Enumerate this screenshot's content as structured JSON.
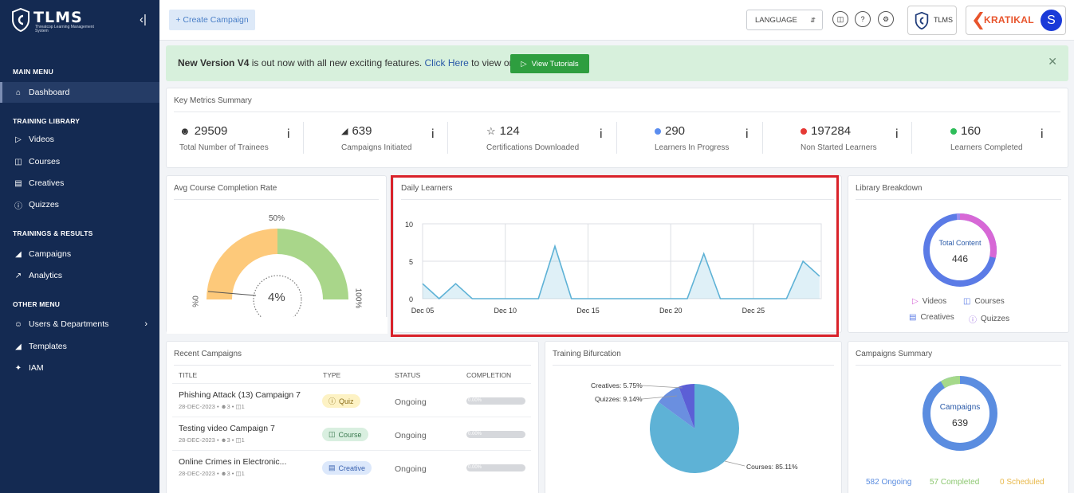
{
  "sidebar": {
    "brand": "TLMS",
    "brand_sub": "Threatcop Learning Management System",
    "collapse_icon": "collapse-icon",
    "sections": {
      "main": "MAIN MENU",
      "library": "TRAINING LIBRARY",
      "results": "TRAININGS & RESULTS",
      "other": "OTHER MENU"
    },
    "items": {
      "dashboard": "Dashboard",
      "videos": "Videos",
      "courses": "Courses",
      "creatives": "Creatives",
      "quizzes": "Quizzes",
      "campaigns": "Campaigns",
      "analytics": "Analytics",
      "users": "Users & Departments",
      "templates": "Templates",
      "iam": "IAM"
    }
  },
  "topbar": {
    "create_campaign": "+ Create Campaign",
    "language": "LANGUAGE",
    "tlms_label": "TLMS",
    "kratikal": "KRATIKAL",
    "avatar": "S"
  },
  "banner": {
    "version": "New Version V4",
    "text_mid": " is out now with all new exciting features. ",
    "link": "Click Here",
    "text_end": " to view or",
    "button": "View Tutorials"
  },
  "metrics": {
    "title": "Key Metrics Summary",
    "items": [
      {
        "value": "29509",
        "label": "Total Number of Trainees"
      },
      {
        "value": "639",
        "label": "Campaigns Initiated"
      },
      {
        "value": "124",
        "label": "Certifications Downloaded"
      },
      {
        "value": "290",
        "label": "Learners In Progress",
        "color": "#5b8def"
      },
      {
        "value": "197284",
        "label": "Non Started Learners",
        "color": "#e53935"
      },
      {
        "value": "160",
        "label": "Learners Completed",
        "color": "#2ebd59"
      }
    ],
    "info": "i"
  },
  "completion": {
    "title": "Avg Course Completion Rate",
    "value": "4%",
    "label_0": "0%",
    "label_50": "50%",
    "label_100": "100%"
  },
  "daily": {
    "title": "Daily Learners"
  },
  "chart_data": {
    "type": "area",
    "y_ticks": [
      "0",
      "5",
      "10"
    ],
    "ylim": [
      0,
      10
    ],
    "x_labels": [
      "Dec 05",
      "Dec 10",
      "Dec 15",
      "Dec 20",
      "Dec 25"
    ],
    "x_start_day": 5,
    "x_end_day": 29,
    "points": [
      {
        "day": 5,
        "v": 2
      },
      {
        "day": 6,
        "v": 0
      },
      {
        "day": 7,
        "v": 2
      },
      {
        "day": 8,
        "v": 0
      },
      {
        "day": 12,
        "v": 0
      },
      {
        "day": 13,
        "v": 7
      },
      {
        "day": 14,
        "v": 0
      },
      {
        "day": 21,
        "v": 0
      },
      {
        "day": 22,
        "v": 6
      },
      {
        "day": 23,
        "v": 0
      },
      {
        "day": 27,
        "v": 0
      },
      {
        "day": 28,
        "v": 5
      },
      {
        "day": 29,
        "v": 3
      }
    ],
    "color": "#5eb2d6"
  },
  "library": {
    "title": "Library Breakdown",
    "center_label": "Total Content",
    "center_value": "446",
    "legend": [
      "Videos",
      "Courses",
      "Creatives",
      "Quizzes"
    ]
  },
  "recent": {
    "title": "Recent Campaigns",
    "headers": [
      "TITLE",
      "TYPE",
      "STATUS",
      "COMPLETION"
    ],
    "rows": [
      {
        "title": "Phishing Attack (13) Campaign 7",
        "date": "28-DEC-2023",
        "users": "3",
        "mods": "1",
        "type": "Quiz",
        "status": "Ongoing",
        "pct": "0.00%"
      },
      {
        "title": "Testing video Campaign 7",
        "date": "28-DEC-2023",
        "users": "3",
        "mods": "1",
        "type": "Course",
        "status": "Ongoing",
        "pct": "0.00%"
      },
      {
        "title": "Online Crimes in Electronic...",
        "date": "28-DEC-2023",
        "users": "3",
        "mods": "1",
        "type": "Creative",
        "status": "Ongoing",
        "pct": "0.00%"
      }
    ]
  },
  "bifurcation": {
    "title": "Training Bifurcation",
    "labels": {
      "creatives": "Creatives: 5.75%",
      "quizzes": "Quizzes: 9.14%",
      "courses": "Courses: 85.11%"
    },
    "slices": [
      {
        "name": "Courses",
        "pct": 85.11,
        "color": "#5eb2d6"
      },
      {
        "name": "Quizzes",
        "pct": 9.14,
        "color": "#6a8fe0"
      },
      {
        "name": "Creatives",
        "pct": 5.75,
        "color": "#5c5fd6"
      }
    ]
  },
  "camp_summary": {
    "title": "Campaigns Summary",
    "center_label": "Campaigns",
    "center_value": "639",
    "ongoing": "582 Ongoing",
    "completed": "57 Completed",
    "scheduled": "0 Scheduled"
  }
}
